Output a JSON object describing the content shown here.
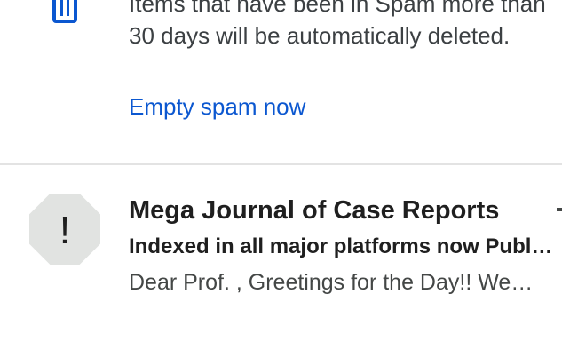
{
  "notice": {
    "line1": "Items that have been in Spam more than",
    "line2": "30 days will be automatically deleted.",
    "action_label": "Empty spam now",
    "icon": "trash-icon"
  },
  "colors": {
    "accent": "#0b57d0",
    "text_primary": "#1f1f1f",
    "text_secondary": "#444746",
    "divider": "#e3e3e3",
    "avatar_bg": "#e1e3e1"
  },
  "emails": [
    {
      "avatar_glyph": "!",
      "avatar_icon": "spam-warning-icon",
      "sender": "Mega Journal of Case Reports",
      "subject": "Indexed in all major platforms now Publish with us",
      "snippet": "Dear Prof. , Greetings for the Day!! We are pleased"
    }
  ]
}
